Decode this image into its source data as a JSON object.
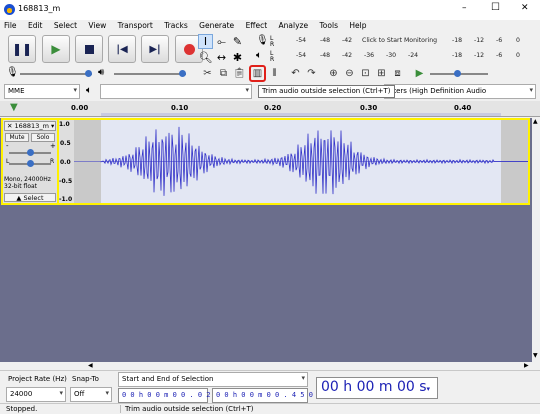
{
  "window": {
    "title": "168813_m",
    "minimize": "–",
    "maximize": "☐",
    "close": "✕"
  },
  "menu": [
    "File",
    "Edit",
    "Select",
    "View",
    "Transport",
    "Tracks",
    "Generate",
    "Effect",
    "Analyze",
    "Tools",
    "Help"
  ],
  "meters": {
    "rec_ticks": [
      "-54",
      "-48",
      "-42",
      "Click to Start Monitoring",
      "-18",
      "-12",
      "-6",
      "0"
    ],
    "play_ticks": [
      "-54",
      "-48",
      "-42",
      "-36",
      "-30",
      "-24",
      "-18",
      "-12",
      "-6",
      "0"
    ],
    "l": "L",
    "r": "R"
  },
  "device": {
    "host": "MME",
    "output": "akers (High Definition Audio"
  },
  "tooltip": "Trim audio outside selection (Ctrl+T)",
  "ruler": {
    "ticks": [
      "0.00",
      "0.10",
      "0.20",
      "0.30",
      "0.40"
    ]
  },
  "track": {
    "name": "168813_m",
    "mute": "Mute",
    "solo": "Solo",
    "gain_minus": "-",
    "gain_plus": "+",
    "pan_l": "L",
    "pan_r": "R",
    "info": "Mono, 24000Hz\n32-bit float",
    "select": "Select",
    "scale": [
      "1.0",
      "0.5",
      "0.0",
      "-0.5",
      "-1.0"
    ]
  },
  "bottom": {
    "rate_label": "Project Rate (Hz)",
    "snap_label": "Snap-To",
    "rate_value": "24000",
    "snap_value": "Off",
    "selection_label": "Start and End of Selection",
    "start_time": "0 0 h 0 0 m 0 0 . 0 2 5 s",
    "end_time": "0 0 h 0 0 m 0 0 . 4 5 0 s",
    "audio_pos": "00 h 00 m 00 s"
  },
  "status": {
    "left": "Stopped.",
    "right": "Trim audio outside selection (Ctrl+T)"
  },
  "colors": {
    "waveform": "#3232c8",
    "wave_bg": "#ffffff",
    "track_bg": "#6b6e8c",
    "selection": "#e3e7f3"
  }
}
